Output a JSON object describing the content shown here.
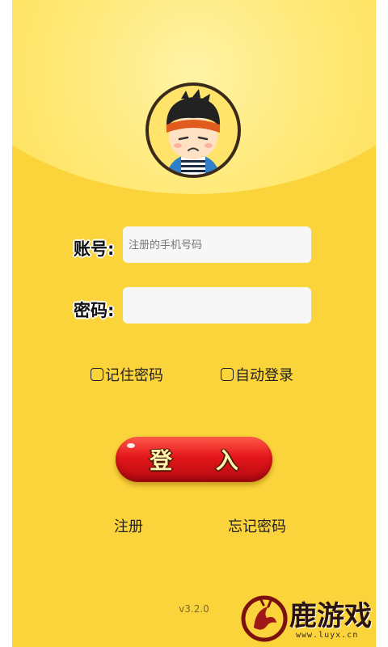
{
  "login": {
    "account_label": "账号:",
    "account_placeholder": "注册的手机号码",
    "password_label": "密码:",
    "password_placeholder": "",
    "remember_password": "记住密码",
    "auto_login": "自动登录",
    "login_button": "登 入",
    "register_link": "注册",
    "forgot_link": "忘记密码"
  },
  "footer": {
    "version": "v3.2.0"
  },
  "watermark": {
    "name": "鹿游戏",
    "url": "www.luyx.cn"
  },
  "colors": {
    "background": "#fbd33a",
    "button_red": "#e4161a",
    "field_bg": "#f7f7f7"
  },
  "icons": {
    "avatar": "cartoon-boy-headband-avatar"
  }
}
